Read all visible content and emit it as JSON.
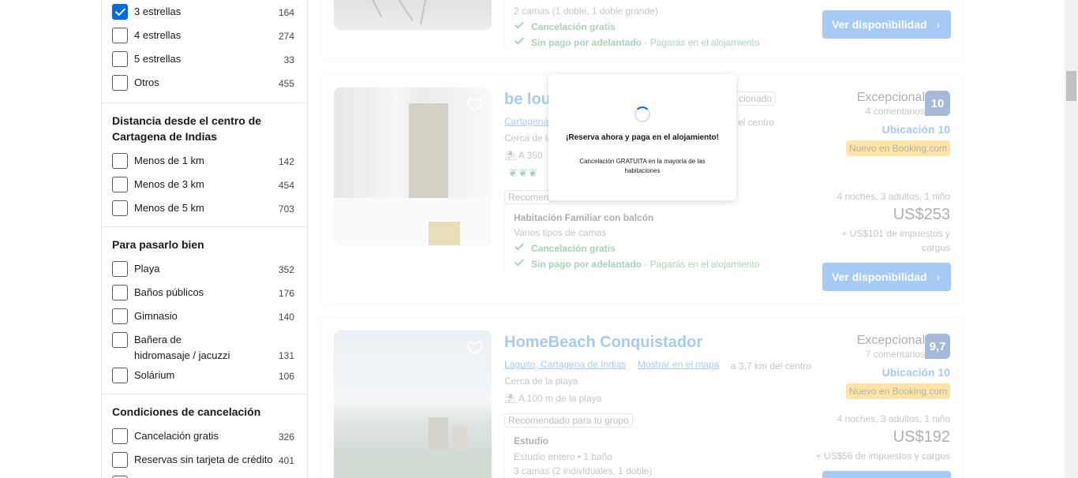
{
  "filters": {
    "stars": [
      {
        "label": "3 estrellas",
        "count": "164",
        "checked": true
      },
      {
        "label": "4 estrellas",
        "count": "274"
      },
      {
        "label": "5 estrellas",
        "count": "33"
      },
      {
        "label": "Otros",
        "count": "455"
      }
    ],
    "distance": {
      "title": "Distancia desde el centro de Cartagena de Indias",
      "items": [
        {
          "label": "Menos de 1 km",
          "count": "142"
        },
        {
          "label": "Menos de 3 km",
          "count": "454"
        },
        {
          "label": "Menos de 5 km",
          "count": "703"
        }
      ]
    },
    "fun": {
      "title": "Para pasarlo bien",
      "items": [
        {
          "label": "Playa",
          "count": "352"
        },
        {
          "label": "Baños públicos",
          "count": "176"
        },
        {
          "label": "Gimnasio",
          "count": "140"
        },
        {
          "label": "Bañera de hidromasaje / jacuzzi",
          "count": "131"
        },
        {
          "label": "Solárium",
          "count": "106"
        }
      ]
    },
    "cancel": {
      "title": "Condiciones de cancelación",
      "items": [
        {
          "label": "Cancelación gratis",
          "count": "326"
        },
        {
          "label": "Reservas sin tarjeta de crédito",
          "count": "401"
        }
      ]
    }
  },
  "card0": {
    "beds": "2 camas (1 doble, 1 doble grande)",
    "free_cancel": "Cancelación gratis",
    "no_prepay": "Sin pago por adelantado",
    "pay_at_property": " - Pagarás en el alojamiento",
    "cta": "Ver disponibilidad"
  },
  "card1": {
    "name": "be lou",
    "tag_partial": "cionado",
    "location": "Cartagena",
    "distance_partial": "el centro",
    "nearby_partial": "Cerca de la",
    "beach_partial": "A 350",
    "recommended_partial": "Recomen",
    "rating_label": "Excepcional",
    "reviews": "4 comentarios",
    "score": "10",
    "location_score": "Ubicación 10",
    "new_badge": "Nuevo en Booking.com",
    "stay": "4 noches, 3 adultos, 1 niño",
    "price": "US$253",
    "taxes": "+ US$101 de impuestos y cargos",
    "room": "Habitación Familiar con balcón",
    "beds": "Varios tipos de camas",
    "free_cancel": "Cancelación gratis",
    "no_prepay": "Sin pago por adelantado",
    "pay_at_property": " - Pagarás en el alojamiento",
    "cta": "Ver disponibilidad"
  },
  "card2": {
    "name": "HomeBeach Conquistador",
    "location": "Laguito, Cartagena de Indias",
    "map_link": "Mostrar en el mapa",
    "distance": "a 3,7 km del centro",
    "nearby": "Cerca de la playa",
    "beach": "A 100 m de la playa",
    "recommended": "Recomendado para tu grupo",
    "rating_label": "Excepcional",
    "reviews": "7 comentarios",
    "score": "9,7",
    "location_score": "Ubicación 10",
    "new_badge": "Nuevo en Booking.com",
    "stay": "4 noches, 3 adultos, 1 niño",
    "price": "US$192",
    "taxes": "+ US$56 de impuestos y cargos",
    "room": "Estudio",
    "room_desc": "Estudio entero • 1 baño",
    "beds": "3 camas (2 individuales, 1 doble)"
  },
  "popup": {
    "title": "¡Reserva ahora y paga en el alojamiento!",
    "subtitle": "Cancelación GRATUITA en la mayoría de las habitaciones"
  }
}
